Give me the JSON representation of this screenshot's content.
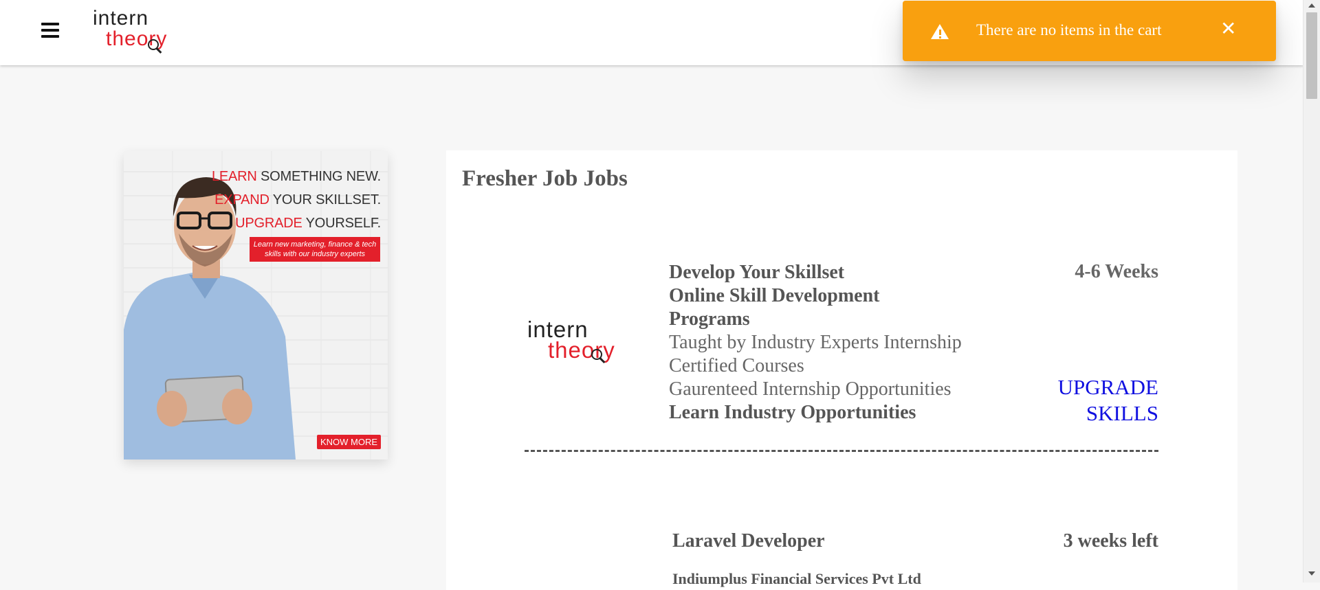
{
  "header": {
    "menu_icon": "hamburger-icon",
    "logo": {
      "line1": "intern",
      "line2": "theory"
    }
  },
  "toast": {
    "icon": "warning-icon",
    "message": "There are no items in the cart",
    "close_label": "✕",
    "color": "#f9a00f"
  },
  "banner": {
    "line1_red": "LEARN",
    "line1_rest": " SOMETHING NEW.",
    "line2_red": "EXPAND",
    "line2_rest": " YOUR SKILLSET.",
    "line3_red": "UPGRADE",
    "line3_rest": " YOURSELF.",
    "subtext": "Learn new marketing, finance & tech skills with our industry experts",
    "cta": "KNOW MORE",
    "accent_color": "#e3202b"
  },
  "main": {
    "title": "Fresher Job Jobs",
    "promo": {
      "logo": {
        "line1": "intern",
        "line2": "theory"
      },
      "heading1": "Develop Your Skillset",
      "heading2": "Online Skill Development Programs",
      "line1": "Taught by Industry Experts Internship Certified Courses",
      "line2": "Gaurenteed Internship Opportunities",
      "line3": "Learn Industry Opportunities",
      "duration": "4-6 Weeks",
      "link_line1": "UPGRADE",
      "link_line2": "SKILLS",
      "link_color": "#1010e0"
    },
    "jobs": [
      {
        "title": "Laravel Developer",
        "company": "Indiumplus Financial Services Pvt Ltd",
        "time_left": "3 weeks left"
      }
    ]
  }
}
